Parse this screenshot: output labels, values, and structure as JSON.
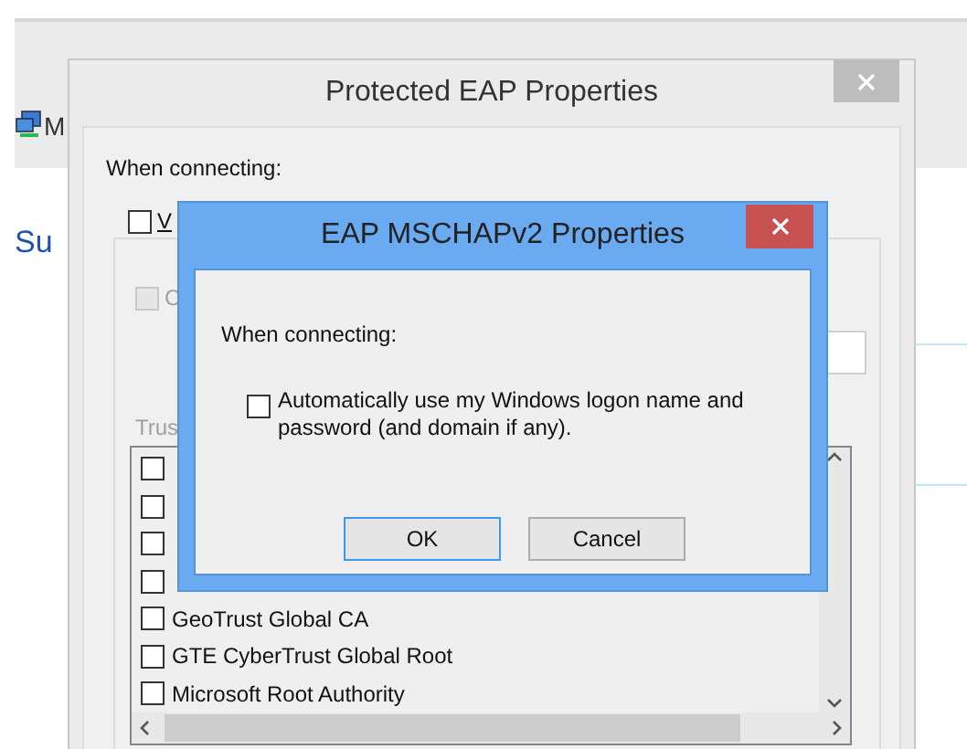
{
  "background_window": {
    "heading_fragment": "M",
    "link_fragment": "Su"
  },
  "peap_dialog": {
    "title": "Protected EAP Properties",
    "when_connecting": "When connecting:",
    "verify_checkbox": {
      "label_fragment": "V",
      "checked": false
    },
    "connect_checkbox": {
      "label_fragment": "C",
      "checked": false,
      "disabled": true
    },
    "trusted_label_fragment": "Trus",
    "cert_list": [
      {
        "checked": false
      },
      {
        "checked": false
      },
      {
        "checked": false
      },
      {
        "checked": false
      },
      {
        "label": "GeoTrust Global CA",
        "checked": false
      },
      {
        "label": "GTE CyberTrust Global Root",
        "checked": false
      },
      {
        "label": "Microsoft Root Authority",
        "checked": false
      }
    ]
  },
  "mschap_dialog": {
    "title": "EAP MSCHAPv2 Properties",
    "when_connecting": "When connecting:",
    "auto_logon": {
      "label": "Automatically use my Windows logon name and password (and domain if any).",
      "checked": false
    },
    "buttons": [
      {
        "label": "OK",
        "default": true
      },
      {
        "label": "Cancel",
        "default": false
      }
    ]
  }
}
